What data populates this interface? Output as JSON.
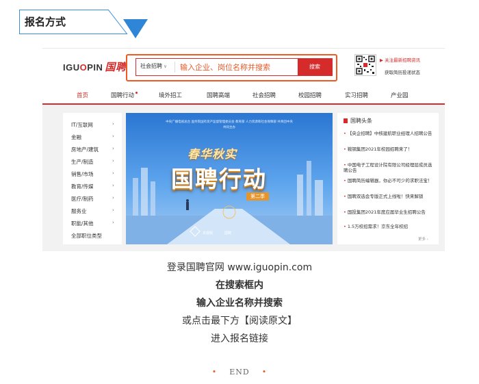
{
  "section": {
    "title": "报名方式"
  },
  "site": {
    "logo_text": "IGU",
    "logo_o": "O",
    "logo_rest": "PIN",
    "logo_cn": "国聘",
    "search": {
      "category": "社会招聘",
      "placeholder": "输入企业、岗位名称并搜索",
      "button": "搜索"
    },
    "follow_label": "▶ 关注最新招聘资讯",
    "follow_sub": "获取简历投递状态",
    "nav": [
      "首页",
      "国聘行动",
      "境外招工",
      "国聘高端",
      "社会招聘",
      "校园招聘",
      "实习招聘",
      "产业园"
    ],
    "categories": [
      "IT/互联网",
      "金融",
      "房地产/建筑",
      "生产/制造",
      "销售/市场",
      "教育/传媒",
      "医疗/制药",
      "服务业",
      "职能/其他",
      "全部职位类型"
    ],
    "banner": {
      "gov_line": "中央广播电视总台  国务院国有资产监督管理委员会  教育部  人力资源和社会保障部  共青团中央",
      "gov_line2": "共同主办",
      "subtitle": "春华秋实",
      "title": "国聘行动",
      "season": "第二季",
      "brand1": "央视频",
      "brand2": "国聘"
    },
    "news": {
      "title": "国聘头条",
      "items": [
        "【央企招聘】中核建航职业经理人招聘公告",
        "鞍钢集团2021年校园招聘来了！",
        "中国电子工程设计院有限公司经理层成员选聘公告",
        "国聘简历编辑器，你必不可少的求职法宝！",
        "国聘双选会专版正式上线啦！快来解锁",
        "国投集团2021年度应届毕业生招聘公告",
        "1.5万校招需求！京东全年校招"
      ],
      "more": "更多 ›"
    }
  },
  "instructions": {
    "line1": "登录国聘官网 www.iguopin.com",
    "line2": "在搜索框内",
    "line3": "输入企业名称并搜索",
    "line4": "或点击最下方【阅读原文】",
    "line5": "进入报名链接"
  },
  "footer": {
    "end": "END",
    "dot": "•"
  }
}
